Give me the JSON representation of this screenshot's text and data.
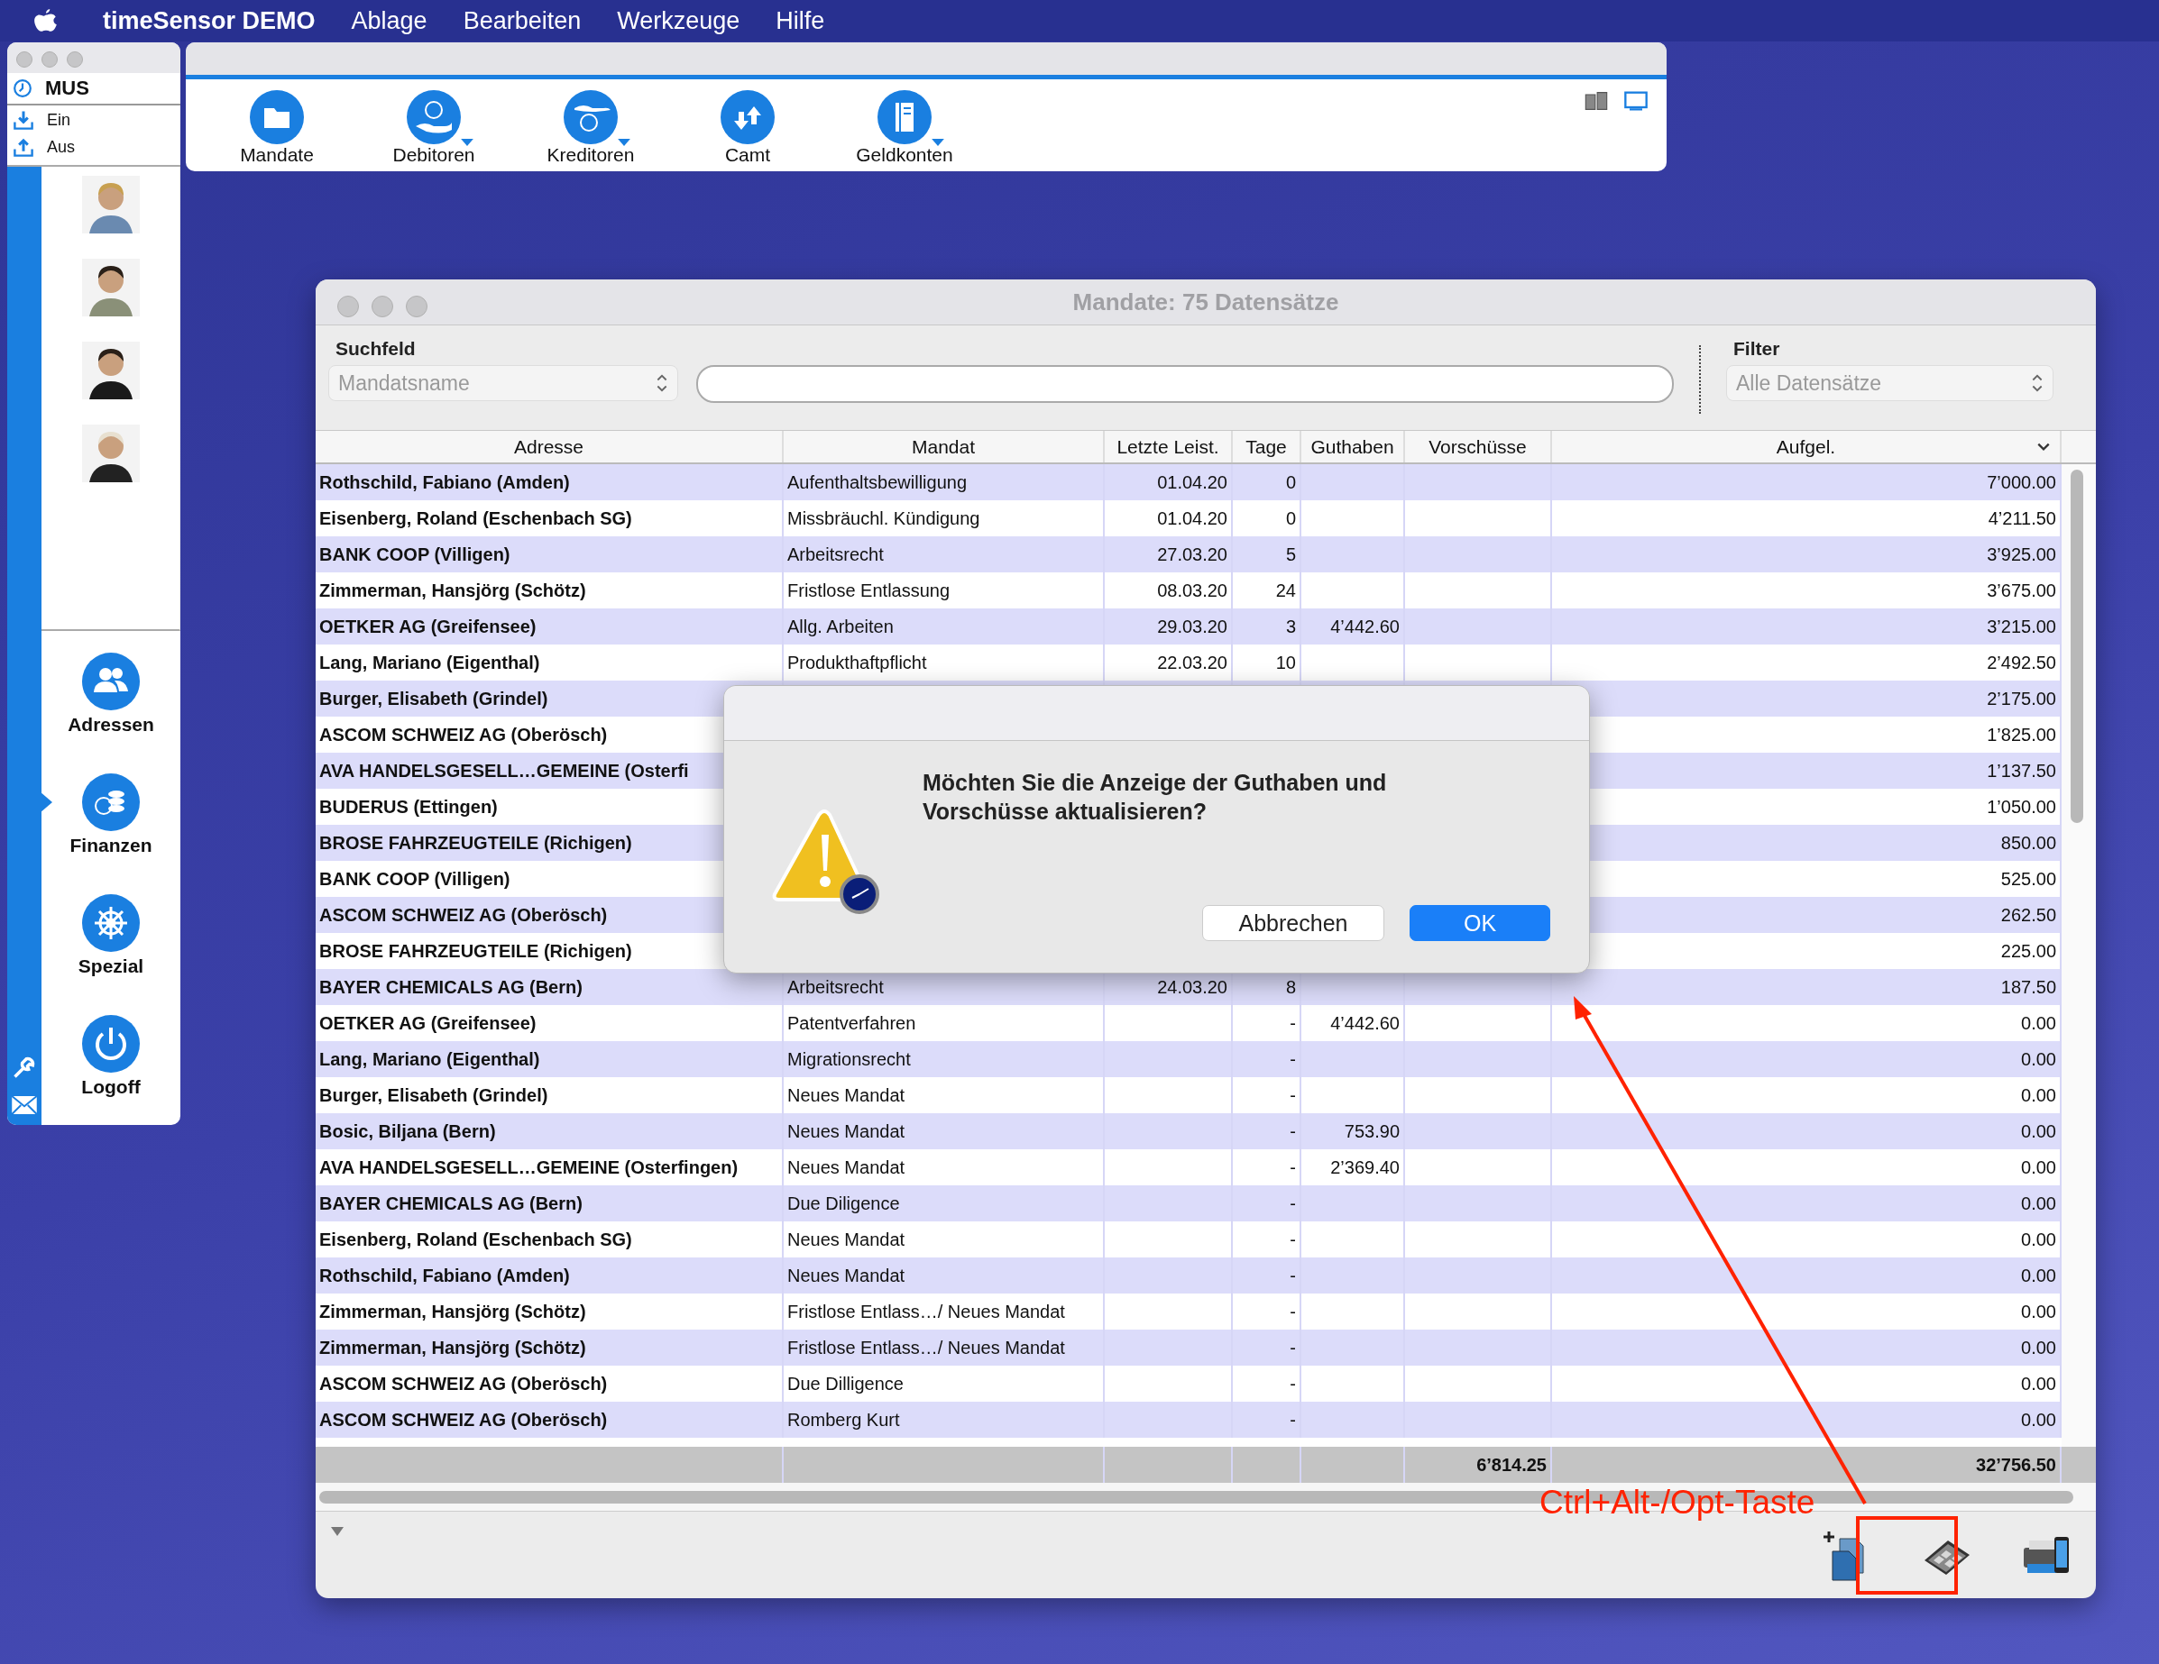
{
  "menu_bar": {
    "app": "timeSensor DEMO",
    "items": [
      "Ablage",
      "Bearbeiten",
      "Werkzeuge",
      "Hilfe"
    ]
  },
  "side_panel": {
    "user": "MUS",
    "actions": [
      {
        "label": "Ein",
        "kind": "in"
      },
      {
        "label": "Aus",
        "kind": "out"
      }
    ],
    "nav": [
      {
        "label": "Adressen",
        "kind": "people",
        "selected": false
      },
      {
        "label": "Finanzen",
        "kind": "coins",
        "selected": true
      },
      {
        "label": "Spezial",
        "kind": "wheel",
        "selected": false
      },
      {
        "label": "Logoff",
        "kind": "power",
        "selected": false
      }
    ]
  },
  "toolbar": {
    "items": [
      {
        "label": "Mandate",
        "kind": "folder",
        "has_menu": false
      },
      {
        "label": "Debitoren",
        "kind": "give",
        "has_menu": true
      },
      {
        "label": "Kreditoren",
        "kind": "receive",
        "has_menu": true
      },
      {
        "label": "Camt",
        "kind": "arrows",
        "has_menu": false
      },
      {
        "label": "Geldkonten",
        "kind": "book",
        "has_menu": true
      }
    ]
  },
  "window": {
    "title": "Mandate: 75 Datensätze",
    "search_label": "Suchfeld",
    "search_by": "Mandatsname",
    "filter_label": "Filter",
    "filter": "Alle Datensätze"
  },
  "table": {
    "columns": [
      {
        "label": "Adresse",
        "sorted": false
      },
      {
        "label": "Mandat",
        "sorted": false
      },
      {
        "label": "Letzte Leist.",
        "sorted": false
      },
      {
        "label": "Tage",
        "sorted": false
      },
      {
        "label": "Guthaben",
        "sorted": false
      },
      {
        "label": "Vorschüsse",
        "sorted": false
      },
      {
        "label": "Aufgel.",
        "sorted": true
      }
    ],
    "rows": [
      {
        "address": "Rothschild, Fabiano (Amden)",
        "mandate": "Aufenthaltsbewilligung",
        "last_service": "01.04.20",
        "days": "0",
        "open": "7’000.00"
      },
      {
        "address": "Eisenberg, Roland (Eschenbach SG)",
        "mandate": "Missbräuchl. Kündigung",
        "last_service": "01.04.20",
        "days": "0",
        "open": "4’211.50"
      },
      {
        "address": "BANK COOP (Villigen)",
        "mandate": "Arbeitsrecht",
        "last_service": "27.03.20",
        "days": "5",
        "open": "3’925.00"
      },
      {
        "address": "Zimmerman, Hansjörg (Schötz)",
        "mandate": "Fristlose Entlassung",
        "last_service": "08.03.20",
        "days": "24",
        "open": "3’675.00"
      },
      {
        "address": "OETKER AG (Greifensee)",
        "mandate": "Allg. Arbeiten",
        "last_service": "29.03.20",
        "days": "3",
        "credit": "4’442.60",
        "open": "3’215.00"
      },
      {
        "address": "Lang, Mariano (Eigenthal)",
        "mandate": "Produkthaftpflicht",
        "last_service": "22.03.20",
        "days": "10",
        "open": "2’492.50"
      },
      {
        "address": "Burger, Elisabeth (Grindel)",
        "open": "2’175.00"
      },
      {
        "address": "ASCOM SCHWEIZ AG (Oberösch)",
        "open": "1’825.00"
      },
      {
        "address": "AVA HANDELSGESELL…GEMEINE (Osterfi",
        "open": "1’137.50"
      },
      {
        "address": "BUDERUS (Ettingen)",
        "open": "1’050.00"
      },
      {
        "address": "BROSE FAHRZEUGTEILE (Richigen)",
        "open": "850.00"
      },
      {
        "address": "BANK COOP (Villigen)",
        "open": "525.00"
      },
      {
        "address": "ASCOM SCHWEIZ AG (Oberösch)",
        "open": "262.50"
      },
      {
        "address": "BROSE FAHRZEUGTEILE (Richigen)",
        "open": "225.00"
      },
      {
        "address": "BAYER CHEMICALS AG (Bern)",
        "mandate": "Arbeitsrecht",
        "last_service": "24.03.20",
        "days": "8",
        "open": "187.50"
      },
      {
        "address": "OETKER AG (Greifensee)",
        "mandate": "Patentverfahren",
        "days": "-",
        "credit": "4’442.60",
        "open": "0.00"
      },
      {
        "address": "Lang, Mariano (Eigenthal)",
        "mandate": "Migrationsrecht",
        "days": "-",
        "open": "0.00"
      },
      {
        "address": "Burger, Elisabeth (Grindel)",
        "mandate": "Neues Mandat",
        "days": "-",
        "open": "0.00"
      },
      {
        "address": "Bosic, Biljana (Bern)",
        "mandate": "Neues Mandat",
        "days": "-",
        "credit": "753.90",
        "open": "0.00"
      },
      {
        "address": "AVA HANDELSGESELL…GEMEINE (Osterfingen)",
        "mandate": "Neues Mandat",
        "days": "-",
        "credit": "2’369.40",
        "open": "0.00"
      },
      {
        "address": "BAYER CHEMICALS AG (Bern)",
        "mandate": "Due Diligence",
        "days": "-",
        "open": "0.00"
      },
      {
        "address": "Eisenberg, Roland (Eschenbach SG)",
        "mandate": "Neues Mandat",
        "days": "-",
        "open": "0.00"
      },
      {
        "address": "Rothschild, Fabiano (Amden)",
        "mandate": "Neues Mandat",
        "days": "-",
        "open": "0.00"
      },
      {
        "address": "Zimmerman, Hansjörg (Schötz)",
        "mandate": "Fristlose Entlass…/ Neues Mandat",
        "days": "-",
        "open": "0.00"
      },
      {
        "address": "Zimmerman, Hansjörg (Schötz)",
        "mandate": "Fristlose Entlass…/ Neues Mandat",
        "days": "-",
        "open": "0.00"
      },
      {
        "address": "ASCOM SCHWEIZ AG (Oberösch)",
        "mandate": "Due Dilligence",
        "days": "-",
        "open": "0.00"
      },
      {
        "address": "ASCOM SCHWEIZ AG (Oberösch)",
        "mandate": "Romberg Kurt",
        "days": "-",
        "open": "0.00"
      }
    ],
    "totals": {
      "advances": "6’814.25",
      "open": "32’756.50"
    }
  },
  "dialog": {
    "message": "Möchten Sie die Anzeige der Guthaben und Vorschüsse aktualisieren?",
    "buttons": [
      {
        "label": "Abbrechen",
        "default": false
      },
      {
        "label": "OK",
        "default": true
      }
    ]
  },
  "annotation": {
    "text": "Ctrl+Alt-/Opt-Taste"
  }
}
